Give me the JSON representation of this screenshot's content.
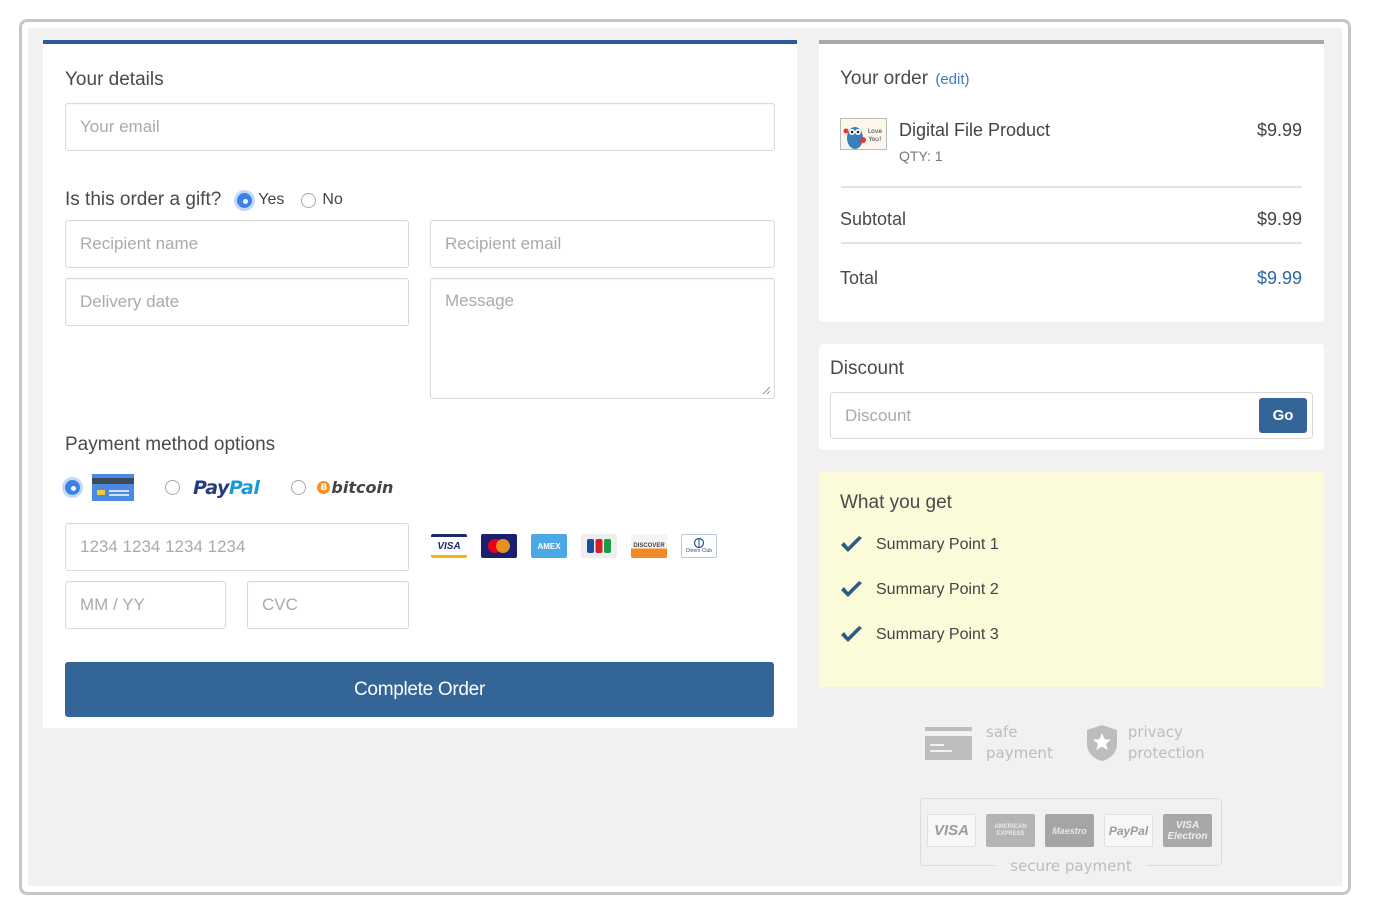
{
  "your_details": {
    "title": "Your details",
    "email_placeholder": "Your email"
  },
  "gift": {
    "question": "Is this order a gift?",
    "options": [
      {
        "label": "Yes",
        "selected": true
      },
      {
        "label": "No",
        "selected": false
      }
    ],
    "recipient_name_placeholder": "Recipient name",
    "recipient_email_placeholder": "Recipient email",
    "delivery_date_placeholder": "Delivery date",
    "message_placeholder": "Message"
  },
  "payment": {
    "title": "Payment method options",
    "methods": [
      {
        "name": "credit-card",
        "selected": true
      },
      {
        "name": "paypal",
        "label_part1": "Pay",
        "label_part2": "Pal",
        "selected": false
      },
      {
        "name": "bitcoin",
        "label": "bitcoin",
        "coin_symbol": "B",
        "selected": false
      }
    ],
    "card_number_placeholder": "1234 1234 1234 1234",
    "expiry_placeholder": "MM / YY",
    "cvc_placeholder": "CVC",
    "accepted_cards": [
      {
        "name": "visa",
        "label": "VISA"
      },
      {
        "name": "mastercard",
        "label": ""
      },
      {
        "name": "amex",
        "label": "AMEX"
      },
      {
        "name": "jcb",
        "label": ""
      },
      {
        "name": "discover",
        "label": "DISCOVER"
      },
      {
        "name": "diners-club",
        "label": "Diners Club"
      }
    ],
    "complete_button": "Complete Order"
  },
  "order": {
    "title": "Your order",
    "edit_label": "(edit)",
    "product": {
      "name": "Digital File Product",
      "qty": "QTY: 1",
      "price": "$9.99",
      "thumb_text": "Love You!"
    },
    "subtotal_label": "Subtotal",
    "subtotal_value": "$9.99",
    "total_label": "Total",
    "total_value": "$9.99"
  },
  "discount": {
    "title": "Discount",
    "placeholder": "Discount",
    "button": "Go"
  },
  "what_you_get": {
    "title": "What you get",
    "items": [
      "Summary Point 1",
      "Summary Point 2",
      "Summary Point 3"
    ]
  },
  "trust": {
    "safe_payment_line1": "safe",
    "safe_payment_line2": "payment",
    "privacy_line1": "privacy",
    "privacy_line2": "protection",
    "secure_logos": [
      "VISA",
      "AMERICAN EXPRESS",
      "Maestro",
      "PayPal",
      "VISA Electron"
    ],
    "secure_label": "secure payment"
  },
  "colors": {
    "primary": "#346597",
    "accent_blue": "#2a5b94",
    "radio_selected": "#3b82e8",
    "summary_bg": "#fbfad9",
    "page_bg": "#f1f1f1"
  }
}
